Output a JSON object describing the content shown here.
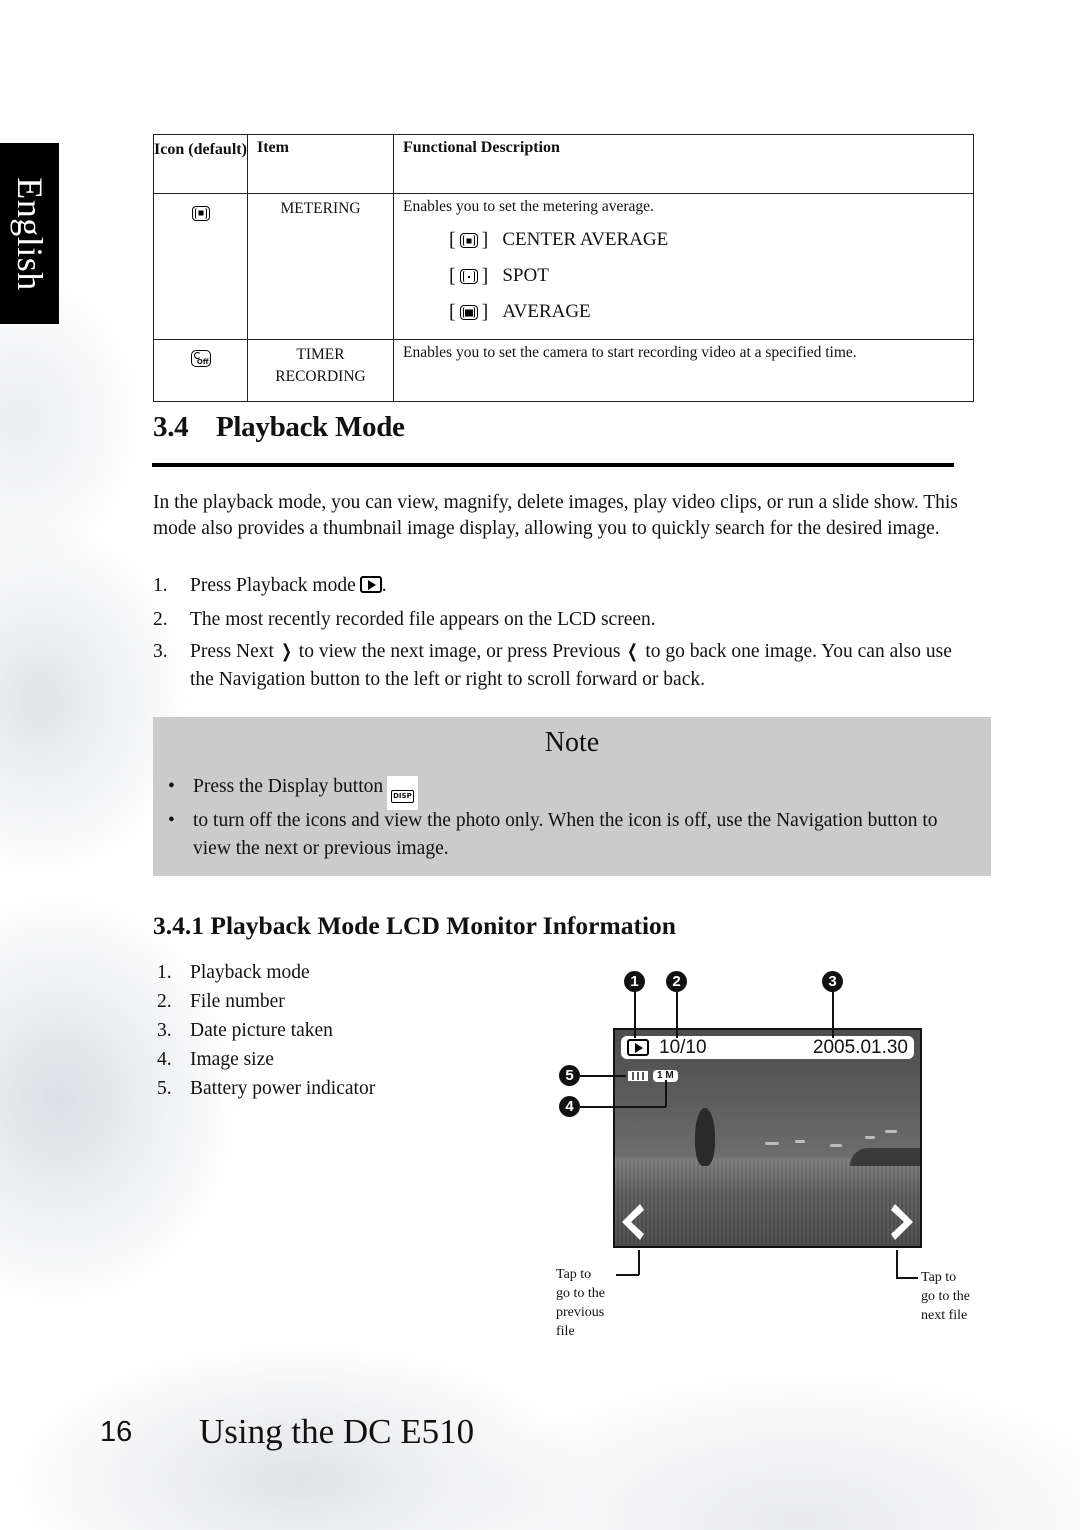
{
  "side_tab": {
    "language": "English"
  },
  "table": {
    "headers": {
      "icon": "Icon (default)",
      "item": "Item",
      "description": "Functional Description"
    },
    "rows": [
      {
        "icon": "metering-center-icon",
        "item": "METERING",
        "description": "Enables you to set the metering average.",
        "options": [
          {
            "icon": "center-average-icon",
            "label": "CENTER AVERAGE"
          },
          {
            "icon": "spot-metering-icon",
            "label": "SPOT"
          },
          {
            "icon": "average-metering-icon",
            "label": "AVERAGE"
          }
        ]
      },
      {
        "icon": "timer-off-icon",
        "item_line1": "TIMER",
        "item_line2": "RECORDING",
        "description": "Enables you to set the camera to start recording video at a specified time."
      }
    ]
  },
  "section": {
    "number": "3.4",
    "title": "Playback Mode",
    "intro": "In the playback mode, you can view, magnify, delete images, play video clips, or run a slide show. This mode also provides a thumbnail image display, allowing you to quickly search for the desired image.",
    "steps": [
      {
        "num": "1.",
        "text_before": "Press Playback mode",
        "icon": "playback-icon",
        "text_after": "."
      },
      {
        "num": "2.",
        "text": "The most recently recorded file appears on the LCD screen."
      },
      {
        "num": "3.",
        "text_a": "Press Next",
        "icon_a": "next-chevron-icon",
        "text_b": "to view the next image, or press Previous",
        "icon_b": "previous-chevron-icon",
        "text_c": "to go back one image. You can also use the Navigation button to the left or right to scroll forward or back."
      }
    ]
  },
  "note": {
    "title": "Note",
    "items": [
      {
        "text": "Press the Display button",
        "icon": "disp-button-icon",
        "icon_text": "DISP"
      },
      {
        "text": " to turn off the icons and view the photo only. When the icon is off, use the Navigation button to view the next or previous image."
      }
    ]
  },
  "subsection": {
    "number": "3.4.1",
    "title": "Playback Mode LCD Monitor Information",
    "items": [
      {
        "num": "1.",
        "label": "Playback mode"
      },
      {
        "num": "2.",
        "label": "File number"
      },
      {
        "num": "3.",
        "label": "Date picture taken"
      },
      {
        "num": "4.",
        "label": "Image size"
      },
      {
        "num": "5.",
        "label": "Battery power indicator"
      }
    ]
  },
  "lcd": {
    "file_number": "10/10",
    "date": "2005.01.30",
    "image_size": "1 M",
    "callouts": [
      "1",
      "2",
      "3",
      "4",
      "5"
    ],
    "caption_prev": [
      "Tap to",
      "go to the",
      "previous",
      "file"
    ],
    "caption_next": [
      "Tap to",
      "go to the",
      "next file"
    ]
  },
  "footer": {
    "page_number": "16",
    "chapter_title": "Using the DC E510"
  }
}
